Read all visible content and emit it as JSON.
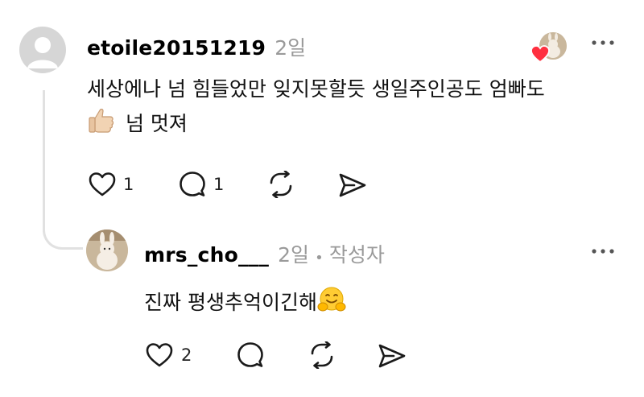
{
  "comment": {
    "username": "etoile20151219",
    "time": "2일",
    "text_line1": "세상에나 넘 힘들었만 잊지못할듯 생일주인공도 엄빠도",
    "text_line2": "넘 멋져",
    "emoji": "thumbs-up-emoji",
    "like_count": "1",
    "reply_count": "1",
    "icons": [
      "heart-icon",
      "comment-icon",
      "repost-icon",
      "send-icon",
      "more-icon"
    ]
  },
  "reply": {
    "username": "mrs_cho___",
    "time": "2일",
    "separator": "•",
    "author_badge": "작성자",
    "text": "진짜 평생추억이긴해",
    "emoji": "hugging-face-emoji",
    "like_count": "2",
    "icons": [
      "heart-icon",
      "comment-icon",
      "repost-icon",
      "send-icon",
      "more-icon"
    ]
  },
  "colors": {
    "text": "#111111",
    "meta": "#9a9a9a",
    "heart_badge": "#ff3040",
    "thread_line": "#e1e1e1"
  }
}
